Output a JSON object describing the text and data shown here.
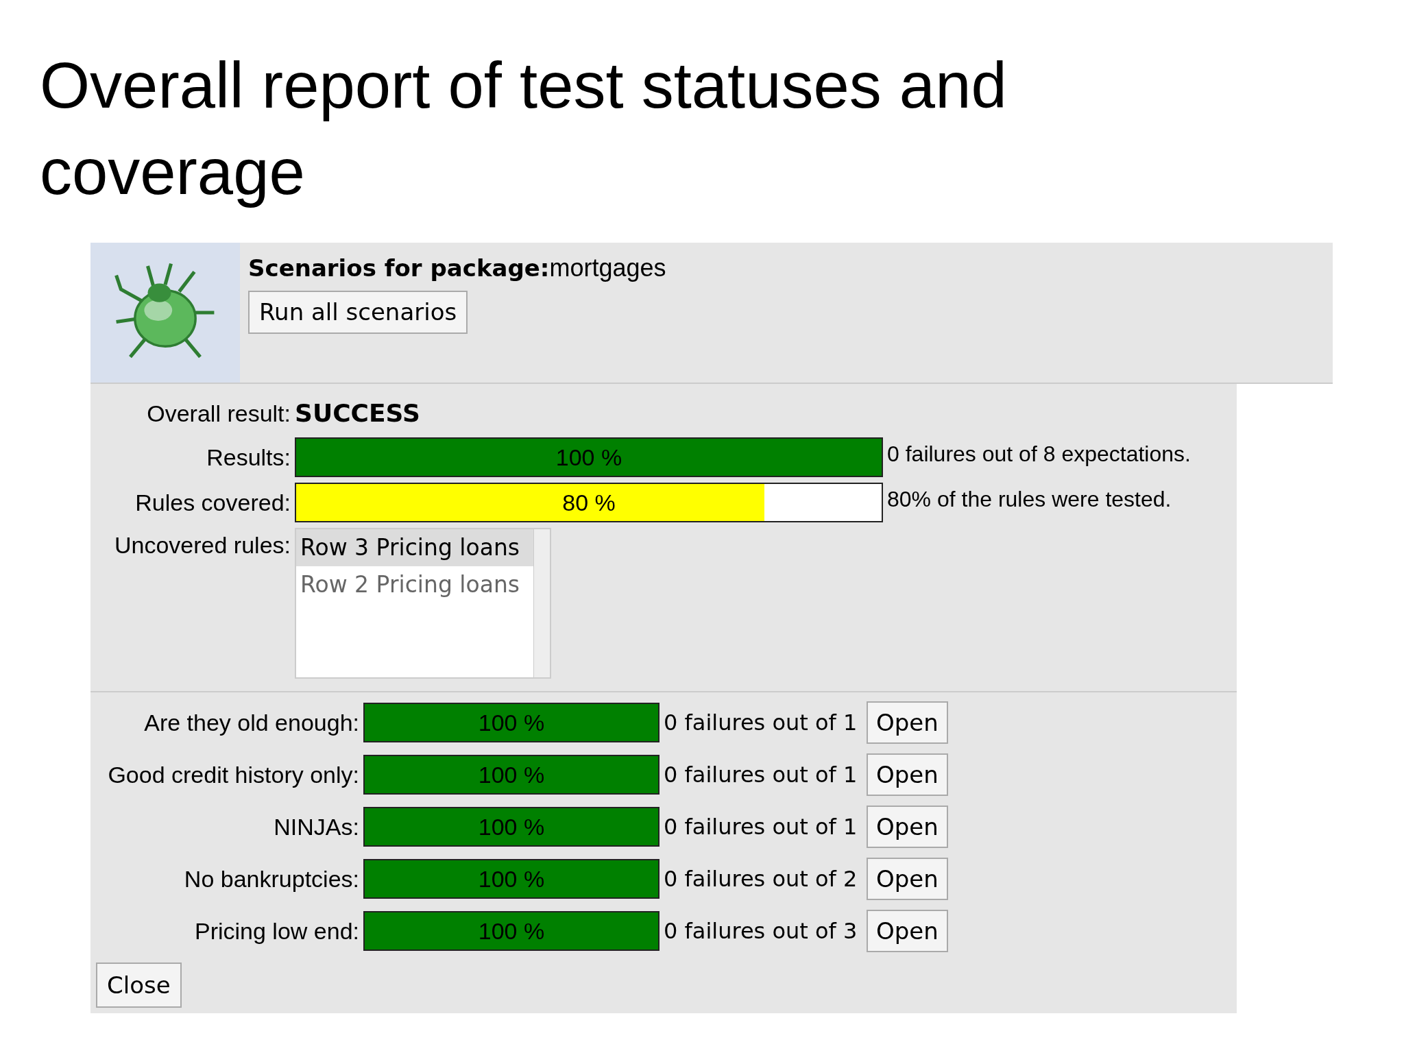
{
  "slide_title": "Overall report of test statuses and coverage",
  "header": {
    "title_bold": "Scenarios for package:",
    "package": "mortgages",
    "run_button": "Run all scenarios"
  },
  "summary": {
    "overall_label": "Overall result:",
    "overall_value": "SUCCESS",
    "bars": [
      {
        "label": "Results:",
        "text": "100 %",
        "level": 1,
        "kind": "success",
        "note": "0 failures out of 8 expectations."
      },
      {
        "label": "Rules covered:",
        "text": "80 %",
        "level": 0.8,
        "kind": "partial",
        "note": "80% of the rules were tested."
      }
    ],
    "uncovered_label": "Uncovered rules:",
    "uncovered": [
      {
        "text": "Row 3 Pricing loans",
        "selected": true
      },
      {
        "text": "Row 2 Pricing loans",
        "selected": false
      }
    ]
  },
  "scenarios": [
    {
      "label": "Are they old enough:",
      "text": "100 %",
      "level": 1,
      "note": "0 failures out of 1",
      "button": "Open"
    },
    {
      "label": "Good credit history only:",
      "text": "100 %",
      "level": 1,
      "note": "0 failures out of 1",
      "button": "Open"
    },
    {
      "label": "NINJAs:",
      "text": "100 %",
      "level": 1,
      "note": "0 failures out of 1",
      "button": "Open"
    },
    {
      "label": "No bankruptcies:",
      "text": "100 %",
      "level": 1,
      "note": "0 failures out of 2",
      "button": "Open"
    },
    {
      "label": "Pricing low end:",
      "text": "100 %",
      "level": 1,
      "note": "0 failures out of 3",
      "button": "Open"
    }
  ],
  "close_button": "Close"
}
